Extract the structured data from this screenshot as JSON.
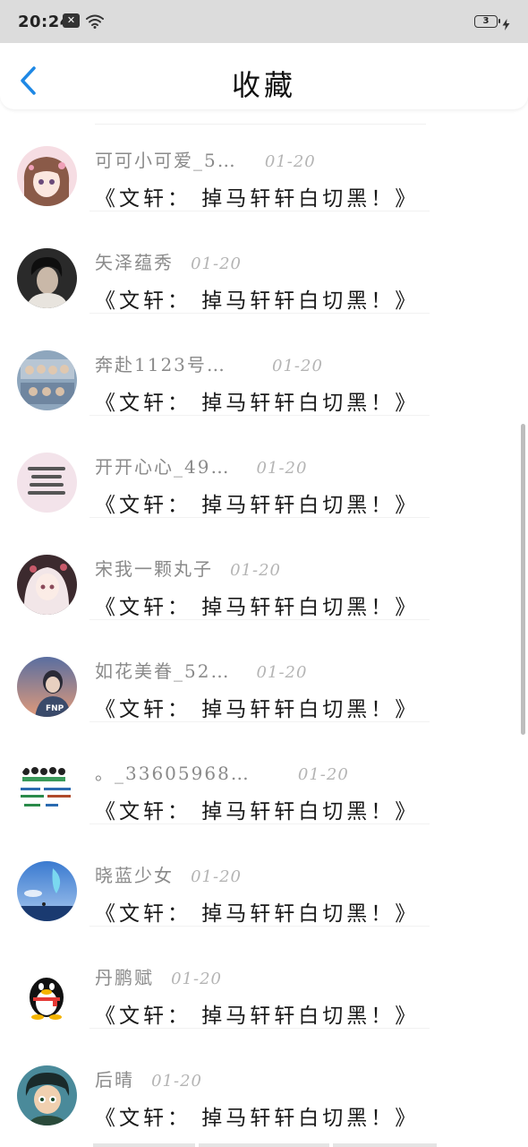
{
  "status_bar": {
    "time": "20:24",
    "notification_glyph": "✕",
    "battery_level": "3",
    "icons": [
      "notification-icon",
      "wifi-icon",
      "battery-icon",
      "charging-bolt-icon"
    ]
  },
  "header": {
    "title": "收藏",
    "back_icon": "chevron-left-icon"
  },
  "colors": {
    "accent": "#1e88e5",
    "status_bar_bg": "#dcdcdc",
    "username": "#8a8a8a",
    "date": "#b4b4b4",
    "title_text": "#1a1a1a"
  },
  "items": [
    {
      "username": "可可小可爱_5…",
      "date": "01-20",
      "title": "《文轩： 掉马轩轩白切黑！》"
    },
    {
      "username": "矢泽蕴秀",
      "date": "01-20",
      "title": "《文轩： 掉马轩轩白切黑！》"
    },
    {
      "username": "奔赴1123号…",
      "date": "01-20",
      "title": "《文轩： 掉马轩轩白切黑！》"
    },
    {
      "username": "开开心心_49…",
      "date": "01-20",
      "title": "《文轩： 掉马轩轩白切黑！》"
    },
    {
      "username": "宋我一颗丸子",
      "date": "01-20",
      "title": "《文轩： 掉马轩轩白切黑！》"
    },
    {
      "username": "如花美眷_52…",
      "date": "01-20",
      "title": "《文轩： 掉马轩轩白切黑！》"
    },
    {
      "username": "。_33605968…",
      "date": "01-20",
      "title": "《文轩： 掉马轩轩白切黑！》"
    },
    {
      "username": "晓蓝少女",
      "date": "01-20",
      "title": "《文轩： 掉马轩轩白切黑！》"
    },
    {
      "username": "丹鹏赋",
      "date": "01-20",
      "title": "《文轩： 掉马轩轩白切黑！》"
    },
    {
      "username": "后晴",
      "date": "01-20",
      "title": "《文轩： 掉马轩轩白切黑！》"
    }
  ]
}
